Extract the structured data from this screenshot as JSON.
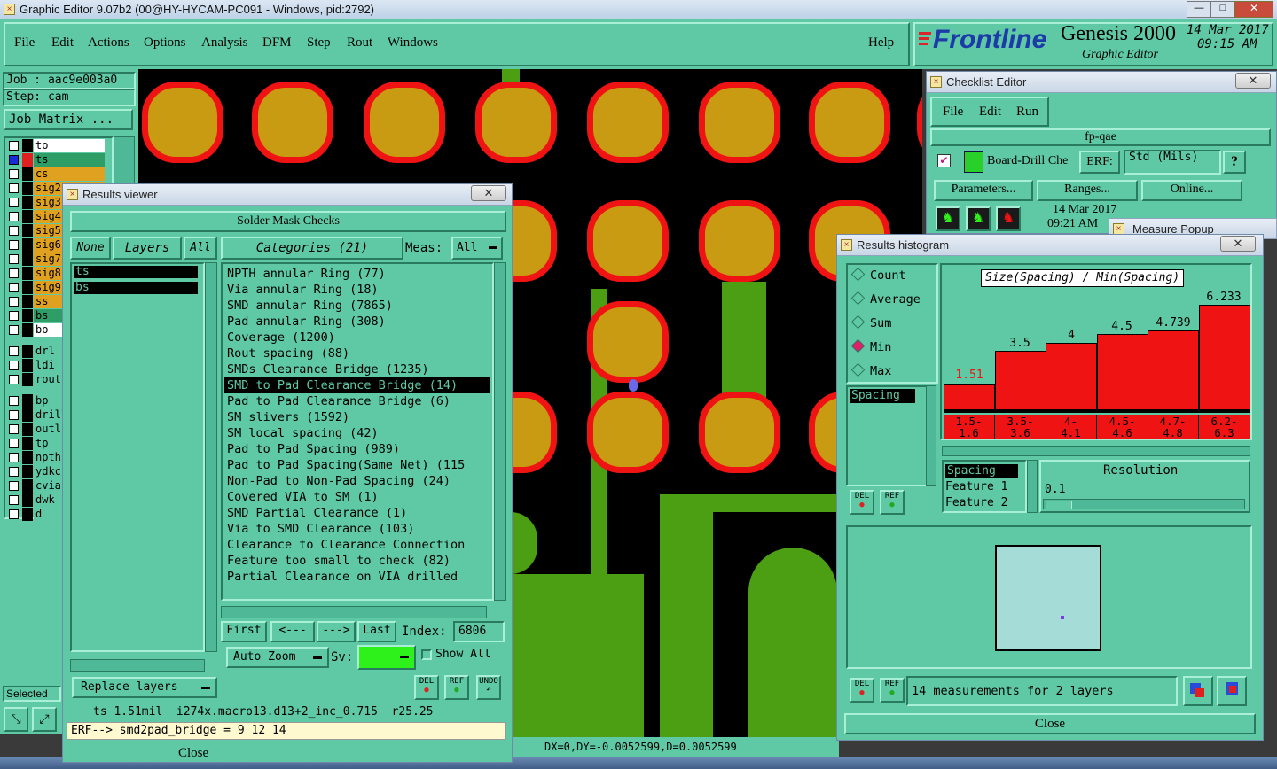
{
  "app": {
    "title": "Graphic Editor 9.07b2 (00@HY-HYCAM-PC091 - Windows, pid:2792)"
  },
  "menu": [
    "File",
    "Edit",
    "Actions",
    "Options",
    "Analysis",
    "DFM",
    "Step",
    "Rout",
    "Windows"
  ],
  "help_label": "Help",
  "brand": {
    "logo": "Frontline",
    "product": "Genesis 2000",
    "subtitle": "Graphic Editor",
    "date": "14 Mar 2017",
    "time": "09:15 AM"
  },
  "job": {
    "job": "Job : aac9e003a0",
    "step": "Step: cam",
    "matrix_button": "Job Matrix ..."
  },
  "layers": [
    {
      "name": "to",
      "color": "#ffffff"
    },
    {
      "name": "ts",
      "color": "#2e9e66"
    },
    {
      "name": "cs",
      "color": "#e0a020"
    },
    {
      "name": "sig2",
      "color": "#e0a020"
    },
    {
      "name": "sig3",
      "color": "#e0a020"
    },
    {
      "name": "sig4",
      "color": "#e0a020"
    },
    {
      "name": "sig5",
      "color": "#e0a020"
    },
    {
      "name": "sig6",
      "color": "#e0a020"
    },
    {
      "name": "sig7",
      "color": "#e0a020"
    },
    {
      "name": "sig8",
      "color": "#e0a020"
    },
    {
      "name": "sig9",
      "color": "#e0a020"
    },
    {
      "name": "ss",
      "color": "#e0a020"
    },
    {
      "name": "bs",
      "color": "#2e9e66"
    },
    {
      "name": "bo",
      "color": "#ffffff"
    },
    {
      "name": "drl",
      "color": "#5fc9a6"
    },
    {
      "name": "ldi",
      "color": "#5fc9a6"
    },
    {
      "name": "rout",
      "color": "#5fc9a6"
    },
    {
      "name": "bp",
      "color": "#5fc9a6"
    },
    {
      "name": "drill",
      "color": "#5fc9a6"
    },
    {
      "name": "outl",
      "color": "#5fc9a6"
    },
    {
      "name": "tp",
      "color": "#5fc9a6"
    },
    {
      "name": "npth",
      "color": "#5fc9a6"
    },
    {
      "name": "ydkc",
      "color": "#5fc9a6"
    },
    {
      "name": "cvia",
      "color": "#5fc9a6"
    },
    {
      "name": "dwk",
      "color": "#5fc9a6"
    },
    {
      "name": "d",
      "color": "#5fc9a6"
    }
  ],
  "selected_label": "Selected",
  "status_bar": "DX=0,DY=-0.0052599,D=0.0052599",
  "results_viewer": {
    "title": "Results viewer",
    "header": "Solder Mask Checks",
    "none": "None",
    "layers": "Layers",
    "all": "All",
    "layer_items": [
      "ts",
      "bs"
    ],
    "categories_label": "Categories (21)",
    "meas_label": "Meas:",
    "meas_value": "All",
    "categories": [
      "NPTH annular Ring (77)",
      "Via annular Ring (18)",
      "SMD annular Ring (7865)",
      "Pad annular Ring (308)",
      "Coverage (1200)",
      "Rout spacing (88)",
      "SMDs Clearance Bridge (1235)",
      "SMD to Pad Clearance Bridge (14)",
      "Pad to Pad Clearance Bridge (6)",
      "SM slivers (1592)",
      "SM local spacing (42)",
      "Pad to Pad Spacing (989)",
      "Pad to Pad Spacing(Same Net) (115",
      "Non-Pad to Non-Pad Spacing (24)",
      "Covered VIA to SM (1)",
      "SMD Partial Clearance (1)",
      "Via to SMD Clearance (103)",
      "Clearance to Clearance Connection",
      "Feature too small to check (82)",
      "Partial Clearance on VIA drilled"
    ],
    "selected_category": 7,
    "first": "First",
    "prev": "<---",
    "next": "--->",
    "last": "Last",
    "index_label": "Index:",
    "index_value": "6806",
    "replace_layers": "Replace layers",
    "auto_zoom": "Auto Zoom",
    "sv_label": "Sv:",
    "show_all": "Show All",
    "del": "DEL",
    "ref": "REF",
    "undo": "UNDO",
    "info_line": "ts 1.51mil  i274x.macro13.d13+2_inc_0.715  r25.25",
    "erf_line": "ERF--> smd2pad_bridge = 9 12 14",
    "close": "Close"
  },
  "checklist": {
    "title": "Checklist Editor",
    "menu": [
      "File",
      "Edit",
      "Run"
    ],
    "name": "fp-qae",
    "check_name": "Board-Drill Che",
    "erf": "ERF:",
    "erf_value": "Std (Mils)",
    "help": "?",
    "parameters": "Parameters...",
    "ranges": "Ranges...",
    "online": "Online...",
    "date": "14 Mar 2017",
    "time": "09:21 AM"
  },
  "measure_popup": {
    "title": "Measure Popup"
  },
  "histogram": {
    "title": "Results histogram",
    "modes": [
      "Count",
      "Average",
      "Sum",
      "Min",
      "Max"
    ],
    "selected_mode": "Min",
    "list_item": "Spacing",
    "chart_title": "Size(Spacing) / Min(Spacing)",
    "bar_labels": [
      "1.51",
      "3.5",
      "4",
      "4.5",
      "4.739",
      "6.233"
    ],
    "ranges": [
      [
        "1.5-",
        "1.6"
      ],
      [
        "3.5-",
        "3.6"
      ],
      [
        "4-",
        "4.1"
      ],
      [
        "4.5-",
        "4.6"
      ],
      [
        "4.7-",
        "4.8"
      ],
      [
        "6.2-",
        "6.3"
      ]
    ],
    "attributes": [
      "Spacing",
      "Feature 1",
      "Feature 2"
    ],
    "resolution_label": "Resolution",
    "resolution_value": "0.1",
    "measurements": "14 measurements for 2 layers",
    "close": "Close",
    "del": "DEL",
    "ref": "REF"
  },
  "chart_data": {
    "type": "bar",
    "title": "Size(Spacing) / Min(Spacing)",
    "categories": [
      "1.5-1.6",
      "3.5-3.6",
      "4-4.1",
      "4.5-4.6",
      "4.7-4.8",
      "6.2-6.3"
    ],
    "values": [
      1.51,
      3.5,
      4,
      4.5,
      4.739,
      6.233
    ],
    "ylim": [
      0,
      6.5
    ],
    "colors": {
      "bar": "#f01313",
      "first_label": "#f01313"
    }
  },
  "colors": {
    "panel": "#5fc9a6",
    "pad_fill": "#c89b12",
    "pad_ring": "#f01313",
    "trace": "#4c9e12"
  }
}
